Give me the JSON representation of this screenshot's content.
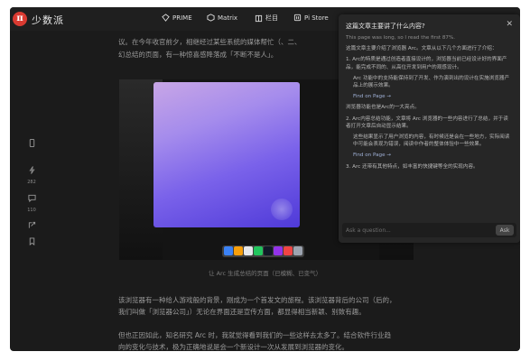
{
  "brand": {
    "logo_glyph": "π",
    "name": "少数派",
    "accent": "#d93a31"
  },
  "nav": [
    {
      "icon": "prime-icon",
      "label": "PRIME"
    },
    {
      "icon": "matrix-icon",
      "label": "Matrix"
    },
    {
      "icon": "columns-icon",
      "label": "栏目"
    },
    {
      "icon": "pistore-icon",
      "label": "Pi Store"
    }
  ],
  "article": {
    "top_line_1": "议。在今年收官前夕，相继经过某些系统的媒体帮忙（、二、",
    "top_line_2": "幻总结的页面，有一种惊喜感降落成「不断不是人」。",
    "caption": "让 Arc 生成总结的页面（已模糊、已变气）",
    "para1_line1": "该浏览器有一种给人游戏般的背景，刚成为一个首发文的旅程。该浏览器背后的公司（后的，",
    "para1_line2": "我们叫做「浏览器公司」）无论在界面还是宣传方面，都显得相当新颖、别致有趣。",
    "para2_line1": "但也正因如此，知名研究 Arc 时，我就觉得看到我们的一些这样去太多了。结合软件行业趋",
    "para2_line2": "向的变化与技术，极为正确地说是会一个新设计一次从发展到浏览器的变化。"
  },
  "side_tools": {
    "like_count": "282",
    "comment_count": "110"
  },
  "dock_colors": [
    "#3b82f6",
    "#f59e0b",
    "#e5e7eb",
    "#22c55e",
    "#111827",
    "#9333ea",
    "#ef4444",
    "#9ca3af"
  ],
  "ai_panel": {
    "title": "这篇文章主要讲了什么内容?",
    "close": "✕",
    "note": "This page was long, so I read the first 87%.",
    "intro": "这篇文章主要介绍了浏览器 Arc。文章从以下几个方面进行了介绍：",
    "point1": "1. Arc的特质是通过创造者直接设计的，浏览器当前已经设计好的界面产品，能完成不同的、从高位开发到用户的观感设计。",
    "point1_sub": "Arc 功能中的支持能保持到了开发、作为演到出的设计在实施浏览器产品上的展示效果。",
    "find1": "Find on Page →",
    "mid": "浏览器功能也是Arc的一大亮点。",
    "point2": "2. Arc内容总结功能，文章将 Arc 浏览器的一些内容进行了总结，并于读者打开文章后自动显示结果。",
    "point2_sub": "这些结果显示了用户浏览的内容，有时候还是会在一些地方，实际阅读中可能会表现为错误，阅读中作者的整体体验中一些效果。",
    "find2": "Find on Page →",
    "point3": "3. Arc 还带有其他特点，如丰富的快捷键等全的实现内容。",
    "ask_placeholder": "Ask a question...",
    "ask_button": "Ask"
  }
}
